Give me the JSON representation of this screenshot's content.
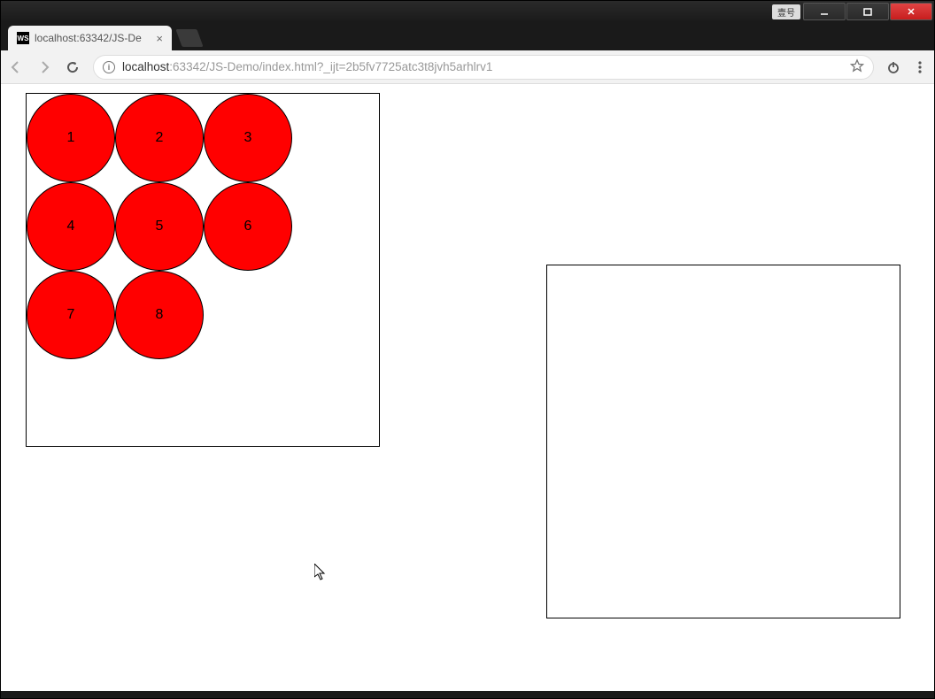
{
  "window": {
    "title_badge": "壹号",
    "tab_title": "localhost:63342/JS-De",
    "favicon_text": "WS"
  },
  "address": {
    "host": "localhost",
    "path": ":63342/JS-Demo/index.html?_ijt=2b5fv7725atc3t8jvh5arhlrv1"
  },
  "circles": [
    "1",
    "2",
    "3",
    "4",
    "5",
    "6",
    "7",
    "8"
  ],
  "colors": {
    "circle_fill": "#ff0000",
    "page_bg": "#ffffff"
  }
}
